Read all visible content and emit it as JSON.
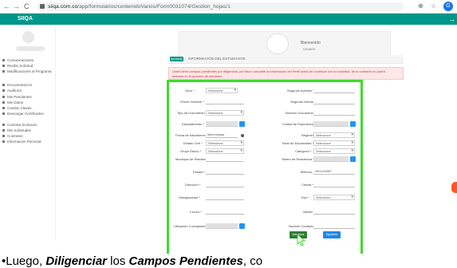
{
  "browser": {
    "back": "←",
    "forward": "→",
    "reload": "C",
    "url_host": "siiqa.com.co",
    "url_path": "/app/formularios/contenidoVarios/Form0031074/Gestion_hojas/1",
    "zoom_icon": "zoom-icon",
    "star_icon": "star-icon",
    "profile_initial": "G"
  },
  "appbar": {
    "logo": "SIIQA",
    "arrow": "→",
    "color": "#009688"
  },
  "sidebar": {
    "items": [
      "Comunicaciones",
      "Recibir Solicitud",
      "Modificaciones al Programa",
      "Documentación",
      "Auditoría",
      "Mis Pendientes",
      "Mis Datos",
      "Cambio Claves",
      "Descargar Certificados",
      "Contrato Exclusivo",
      "Mis Solicitudes",
      "Contratos",
      "Información Personal"
    ]
  },
  "profile": {
    "name": "Bienvenido",
    "sub": "Usuario"
  },
  "info_strip": {
    "badge": "Aprobado",
    "text": "INFORMACIÓN DEL ESTUDIANTE"
  },
  "alert": {
    "line1": "Usted tiene campos pendientes por diligenciar, por favor complete la información del Perfil antes de continuar con su solicitud, de lo contrario no podrá",
    "line2": "avanzar en el proceso de admisión."
  },
  "form": {
    "rows": [
      {
        "left_label": "Sexo *",
        "left_value": "Seleccione",
        "right_label": "Segundo Apellido *",
        "right_value": ""
      },
      {
        "left_label": "Primer Nombre *",
        "left_value": "",
        "right_label": "Segundo Nombre",
        "right_value": ""
      },
      {
        "left_label": "Tipo de Documento *",
        "left_value": "Seleccione",
        "right_label": "Número Documento *",
        "right_value": ""
      },
      {
        "left_label": "Departamento *",
        "left_value": "",
        "right_label": "Ciudad de Expedición *",
        "right_value": ""
      },
      {
        "left_label": "Fecha de Nacimiento *",
        "left_value": "dd/mm/aaaa",
        "right_label": "Régimen *",
        "right_value": "Seleccione"
      },
      {
        "left_label": "Estado Civil *",
        "left_value": "Seleccione",
        "right_label": "Nivel de Escolaridad *",
        "right_value": "Seleccione"
      },
      {
        "left_label": "Grupo Étnico *",
        "left_value": "Seleccione",
        "right_label": "Categoría *",
        "right_value": "Seleccione"
      },
      {
        "left_label": "Municipio de Residencia *",
        "left_value": "",
        "right_label": "Barrio de Residencia *",
        "right_value": ""
      },
      {
        "left_label": "Estrato *",
        "left_value": "",
        "right_label": "Teléfono *",
        "right_value": "3001234567"
      },
      {
        "left_label": "Dirección *",
        "left_value": "",
        "right_label": "Celular *",
        "right_value": ""
      },
      {
        "left_label": "Discapacidad *",
        "left_value": "",
        "right_label": "Eps *",
        "right_value": "Seleccione"
      },
      {
        "left_label": "Correo *",
        "left_value": "",
        "right_label": "Sisbén",
        "right_value": ""
      },
      {
        "left_label": "Ubicación Corregimiento",
        "left_value": "",
        "right_label": "Nombre Contacto",
        "right_value": ""
      }
    ]
  },
  "buttons": {
    "save": "Actualizar",
    "next": "Siguiente",
    "save_color": "#2e7d32",
    "next_color": "#1e88e5"
  },
  "highlight_color": "#3ddc2a",
  "caption": {
    "lead": "•Luego, ",
    "em1": "Diligenciar",
    "mid": " los ",
    "em2": "Campos Pendientes",
    "tail": ", co"
  }
}
